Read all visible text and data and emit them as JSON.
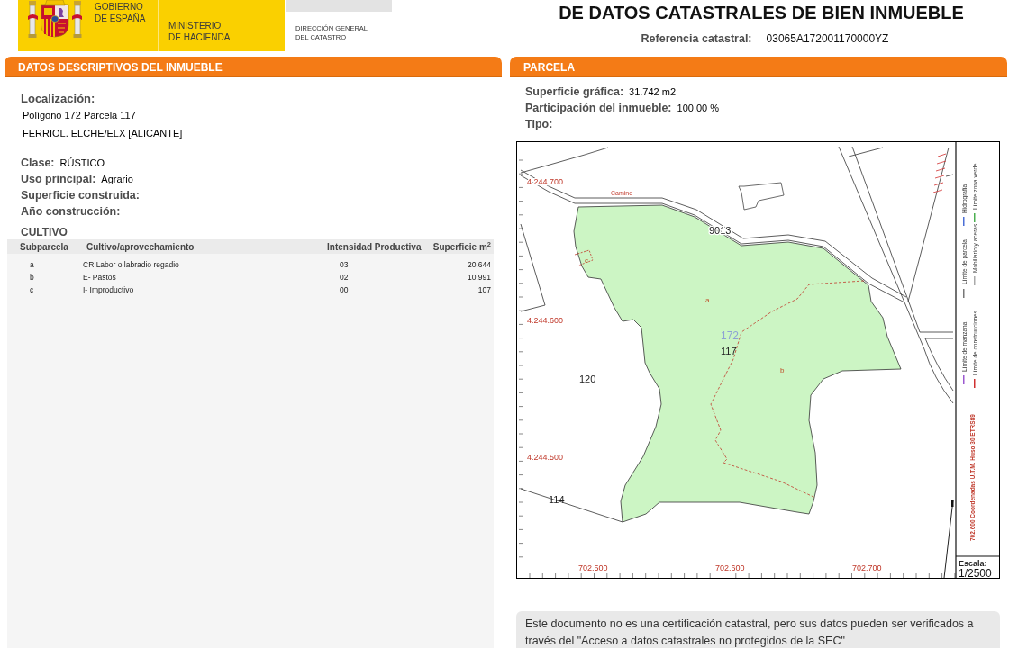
{
  "header": {
    "government": [
      "GOBIERNO",
      "DE ESPAÑA"
    ],
    "ministry": [
      "MINISTERIO",
      "DE HACIENDA"
    ],
    "directorate": [
      "DIRECCIÓN GENERAL",
      "DEL CATASTRO"
    ],
    "title": "DE DATOS CATASTRALES DE BIEN INMUEBLE",
    "reference_label": "Referencia catastral:",
    "reference_value": "03065A172001170000YZ"
  },
  "descriptive": {
    "heading": "DATOS DESCRIPTIVOS DEL INMUEBLE",
    "location_label": "Localización:",
    "location_lines": [
      "Polígono 172 Parcela 117",
      "FERRIOL. ELCHE/ELX [ALICANTE]"
    ],
    "fields": [
      {
        "label": "Clase:",
        "value": "RÚSTICO"
      },
      {
        "label": "Uso principal:",
        "value": "Agrario"
      },
      {
        "label": "Superficie construida:"
      },
      {
        "label": "Año construcción:"
      }
    ],
    "cultivo": {
      "title": "CULTIVO",
      "columns": [
        "Subparcela",
        "Cultivo/aprovechamiento",
        "Intensidad Productiva",
        "Superficie m$^{2}$"
      ],
      "rows": [
        [
          "a",
          "CR Labor o labradio regadio",
          "03",
          "20.644"
        ],
        [
          "b",
          "E- Pastos",
          "02",
          "10.991"
        ],
        [
          "c",
          "I- Improductivo",
          "00",
          "107"
        ]
      ]
    }
  },
  "parcel": {
    "heading": "PARCELA",
    "fields": [
      {
        "label": "Superficie gráfica:",
        "value": "31.742 m2"
      },
      {
        "label": "Participación del inmueble:",
        "value": "100,00 %"
      },
      {
        "label": "Tipo:"
      }
    ],
    "map": {
      "labels": [
        {
          "text": "4.244.700",
          "kind": "northing"
        },
        {
          "text": "Camino",
          "kind": "road_name"
        },
        {
          "text": "9013",
          "kind": "road_number"
        },
        {
          "text": "c",
          "kind": "subparcel"
        },
        {
          "text": "a",
          "kind": "subparcel"
        },
        {
          "text": "4.244.600",
          "kind": "northing"
        },
        {
          "text": "172",
          "kind": "polygon"
        },
        {
          "text": "117",
          "kind": "parcel"
        },
        {
          "text": "b",
          "kind": "subparcel"
        },
        {
          "text": "120",
          "kind": "parcel"
        },
        {
          "text": "4.244.500",
          "kind": "northing"
        },
        {
          "text": "114",
          "kind": "parcel"
        },
        {
          "text": "702.500",
          "kind": "easting"
        },
        {
          "text": "702.600",
          "kind": "easting"
        },
        {
          "text": "702.700",
          "kind": "easting"
        }
      ],
      "legend": [
        {
          "label": "Límite de manzana",
          "color": "#9b59d0"
        },
        {
          "label": "Límite de parcela",
          "color": "#777777"
        },
        {
          "label": "Hidrografía",
          "color": "#4b6fd6"
        },
        {
          "label": "Límite de construcciones",
          "color": "#d03030"
        },
        {
          "label": "Mobiliario y aceras",
          "color": "#aaaaaa"
        },
        {
          "label": "Límite zona verde",
          "color": "#4caf50"
        }
      ],
      "coordinate_note": "702.600 Coordenadas U.T.M. Huso 30 ETRS89",
      "scale_label": "Escala:",
      "scale_value": "1/2500"
    }
  },
  "notice": "Este documento no es una certificación catastral, pero sus datos pueden ser verificados a través del \"Acceso a datos catastrales no protegidos de la SEC\""
}
